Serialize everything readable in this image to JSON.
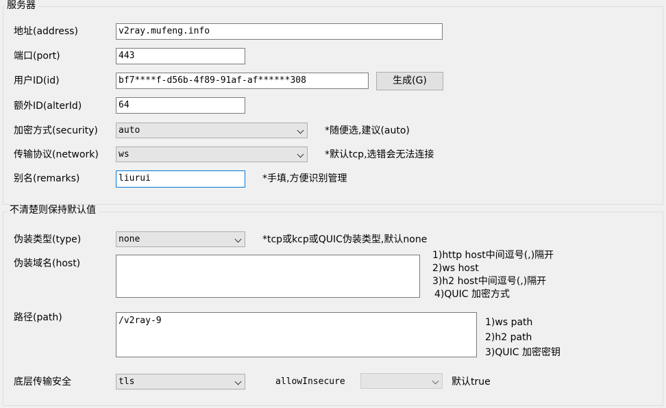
{
  "server_group": {
    "title": "服务器",
    "address": {
      "label": "地址(address)",
      "value": "v2ray.mufeng.info"
    },
    "port": {
      "label": "端口(port)",
      "value": "443"
    },
    "id": {
      "label": "用户ID(id)",
      "value": "bf7****f-d56b-4f89-91af-af******308",
      "generate_label": "生成(G)"
    },
    "alter_id": {
      "label": "额外ID(alterId)",
      "value": "64"
    },
    "security": {
      "label": "加密方式(security)",
      "value": "auto",
      "hint": "*随便选,建议(auto)"
    },
    "network": {
      "label": "传输协议(network)",
      "value": "ws",
      "hint": "*默认tcp,选错会无法连接"
    },
    "remarks": {
      "label": "别名(remarks)",
      "value": "liurui",
      "hint": "*手填,方便识别管理"
    }
  },
  "advanced_group": {
    "title": "不清楚则保持默认值",
    "type": {
      "label": "伪装类型(type)",
      "value": "none",
      "hint": "*tcp或kcp或QUIC伪装类型,默认none"
    },
    "host": {
      "label": "伪装域名(host)",
      "value": "",
      "hints": [
        "1)http host中间逗号(,)隔开",
        "2)ws host",
        "3)h2 host中间逗号(,)隔开",
        "4)QUIC 加密方式"
      ]
    },
    "path": {
      "label": "路径(path)",
      "value": "/v2ray-9",
      "hints": [
        "1)ws path",
        "2)h2 path",
        "3)QUIC 加密密钥"
      ]
    },
    "stream_security": {
      "label": "底层传输安全",
      "value": "tls"
    },
    "allow_insecure": {
      "label": "allowInsecure",
      "value": "",
      "hint": "默认true"
    }
  }
}
